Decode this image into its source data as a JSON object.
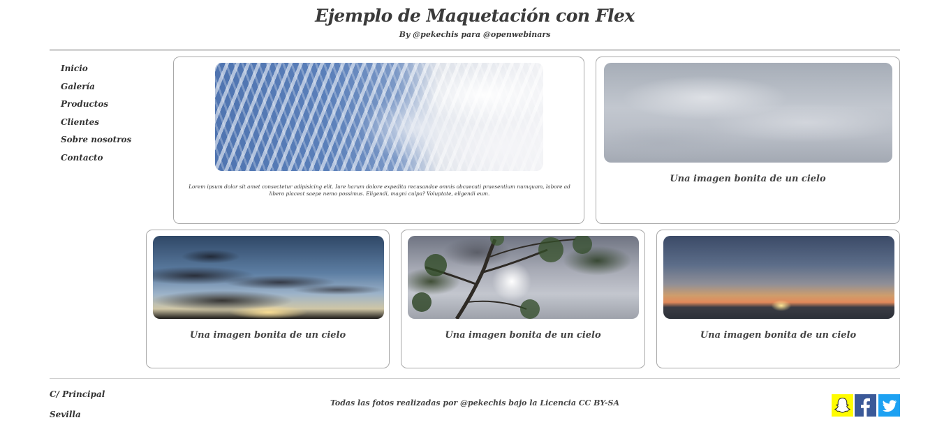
{
  "header": {
    "title": "Ejemplo de Maquetación con Flex",
    "subtitle": "By @pekechis para @openwebinars"
  },
  "sidebar": {
    "items": [
      {
        "label": "Inicio"
      },
      {
        "label": "Galería"
      },
      {
        "label": "Productos"
      },
      {
        "label": "Clientes"
      },
      {
        "label": "Sobre nosotros"
      },
      {
        "label": "Contacto"
      }
    ]
  },
  "gallery": {
    "featured_text": "Lorem ipsum dolor sit amet consectetur adipisicing elit. Iure harum dolore expedita recusandae omnis obcaecati praesentium numquam, labore ad libero placeat saepe nemo possimus. Eligendi, magni culpa? Voluptate, eligendi eum.",
    "cards": [
      {
        "caption": "Una imagen bonita de un cielo"
      },
      {
        "caption": "Una imagen bonita de un cielo"
      },
      {
        "caption": "Una imagen bonita de un cielo"
      },
      {
        "caption": "Una imagen bonita de un cielo"
      }
    ]
  },
  "footer": {
    "address_line1": "C/ Principal",
    "address_line2": "Sevilla",
    "credits": "Todas las fotos realizadas por @pekechis bajo la Licencia CC BY-SA",
    "social": [
      {
        "icon": "snapchat-icon",
        "color": "#fffc00"
      },
      {
        "icon": "facebook-icon",
        "color": "#3b5998"
      },
      {
        "icon": "twitter-icon",
        "color": "#1da1f2"
      }
    ]
  }
}
